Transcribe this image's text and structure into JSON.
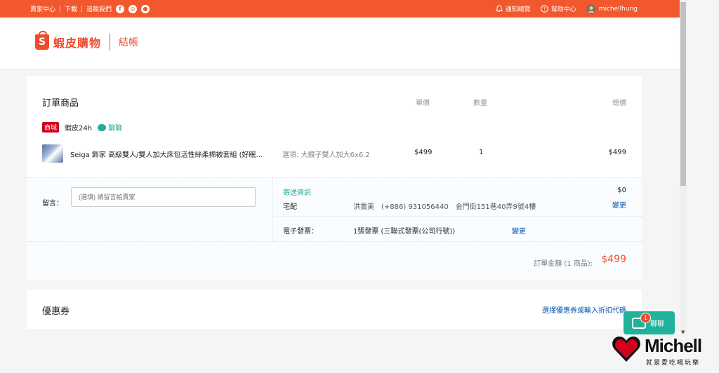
{
  "topbar": {
    "seller_center": "賣家中心",
    "download": "下載",
    "follow_us": "追蹤我們",
    "notifications": "通知總覽",
    "help_center": "幫助中心",
    "username": "michellhung"
  },
  "header": {
    "logo_text": "蝦皮購物",
    "logo_glyph": "S",
    "page_title": "結帳"
  },
  "order": {
    "section_title": "訂單商品",
    "col_unit_price": "單價",
    "col_quantity": "數量",
    "col_total": "總價",
    "shop_badge": "商城",
    "shop_name": "蝦皮24h",
    "chat_label": "聊聊",
    "item": {
      "name": "Seiga 飾家 高級雙人/雙人加大床包活性絲柔棉被套組 (好眠…",
      "variation": "選項: 大髖子雙人加大6x6.2",
      "unit_price": "$499",
      "quantity": "1",
      "total": "$499"
    },
    "message_label": "留言：",
    "message_placeholder": "(選填) 請留言給賣家",
    "shipping": {
      "title": "寄送資訊",
      "method": "宅配",
      "recipient": "洪雲美　(+886) 931056440　金門街151巷40弄9號4樓",
      "fee": "$0",
      "change": "變更"
    },
    "invoice": {
      "label": "電子發票：",
      "value": "1張發票 (三聯式發票(公司行號))",
      "change": "變更"
    },
    "total_label": "訂單金額 (1 商品):",
    "total_value": "$499"
  },
  "coupon": {
    "title": "優惠券",
    "link": "選擇優惠券或輸入折扣代碼"
  },
  "chat_fab": {
    "label": "聊聊",
    "badge": "1"
  },
  "watermark": {
    "name": "Michell",
    "tagline": "就是愛吃喝玩樂"
  },
  "colors": {
    "brand": "#ee4d2d",
    "topbar": "#f1582d",
    "link": "#0055aa",
    "teal": "#26aa99"
  }
}
